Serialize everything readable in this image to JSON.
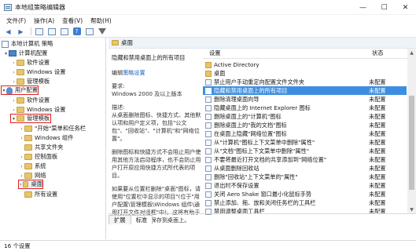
{
  "window": {
    "title": "本地组策略编辑器",
    "minimize": "—",
    "maximize": "☐",
    "close": "✕"
  },
  "menu": [
    "文件(F)",
    "操作(A)",
    "查看(V)",
    "帮助(H)"
  ],
  "tree": {
    "root": "本地计算机 策略",
    "computer_config": "计算机配置",
    "software_settings": "软件设置",
    "windows_settings": "Windows 设置",
    "admin_templates_1": "管理模板",
    "user_config": "用户配置",
    "software_settings_2": "软件设置",
    "windows_settings_2": "Windows 设置",
    "admin_templates_2": "管理模板",
    "start_menu": "\"开始\"菜单和任务栏",
    "windows_components": "Windows 组件",
    "shared_folders": "共享文件夹",
    "control_panel": "控制面板",
    "system": "系统",
    "network": "网络",
    "desktop": "桌面",
    "all_settings": "所有设置"
  },
  "desc": {
    "header": "桌面",
    "title": "隐藏和禁用桌面上的所有项目",
    "edit_label": "编辑",
    "edit_link": "策略设置",
    "req_label": "要求:",
    "req_value": "Windows 2000 及以上版本",
    "desc_label": "描述:",
    "desc_p1": "从桌面删除图标、快捷方式、其他默认项和用户定义项，包括\"公文包\"、\"回收站\"、\"计算机\"和\"网络位置\"。",
    "desc_p2": "删除图标和快捷方式不会阻止用户使用其他方法启动程序，也不会防止用户打开原应用快捷方式所代表的项目。",
    "desc_p3": "如果要从位置栏删除\"桌面\"图标，请使用\"位置栏中显示的项目\"(位于\"用户配置\\管理模板\\Windows 组件\\通用打开文件对话框\"中)。这将有助于防止用户将数据保存到桌面上。"
  },
  "list": {
    "col_setting": "设置",
    "col_state": "状态",
    "rows": [
      {
        "name": "Active Directory",
        "state": "",
        "folder": true
      },
      {
        "name": "桌面",
        "state": "",
        "folder": true
      },
      {
        "name": "禁止用户手动重定向配置文件文件夹",
        "state": "未配置"
      },
      {
        "name": "隐藏和禁用桌面上的所有项目",
        "state": "未配置",
        "selected": true
      },
      {
        "name": "删除清理桌面向导",
        "state": "未配置"
      },
      {
        "name": "隐藏桌面上的 Internet Explorer 图标",
        "state": "未配置"
      },
      {
        "name": "删除桌面上的\"计算机\"图标",
        "state": "未配置"
      },
      {
        "name": "删除桌面上的\"我的文档\"图标",
        "state": "未配置"
      },
      {
        "name": "在桌面上隐藏\"网络位置\"图标",
        "state": "未配置"
      },
      {
        "name": "从\"计算机\"图标上下文菜单中删除\"属性\"",
        "state": "未配置"
      },
      {
        "name": "从\"文档\"图标上下文菜单中删除\"属性\"",
        "state": "未配置"
      },
      {
        "name": "不要将最近打开文档的共享添加到\"网络位置\"",
        "state": "未配置"
      },
      {
        "name": "从桌面删除回收站",
        "state": "未配置"
      },
      {
        "name": "删除\"回收站\"上下文菜单的\"属性\"",
        "state": "未配置"
      },
      {
        "name": "退出时不保存设置",
        "state": "未配置"
      },
      {
        "name": "关闭 Aero Shake 窗口最小化鼠标手势",
        "state": "未配置"
      },
      {
        "name": "禁止添加、拖、放和关闭任务栏的工具栏",
        "state": "未配置"
      },
      {
        "name": "禁用调整桌面工具栏",
        "state": "未配置"
      }
    ]
  },
  "tabs": {
    "extended": "扩展",
    "standard": "标准"
  },
  "status": "16 个设置"
}
